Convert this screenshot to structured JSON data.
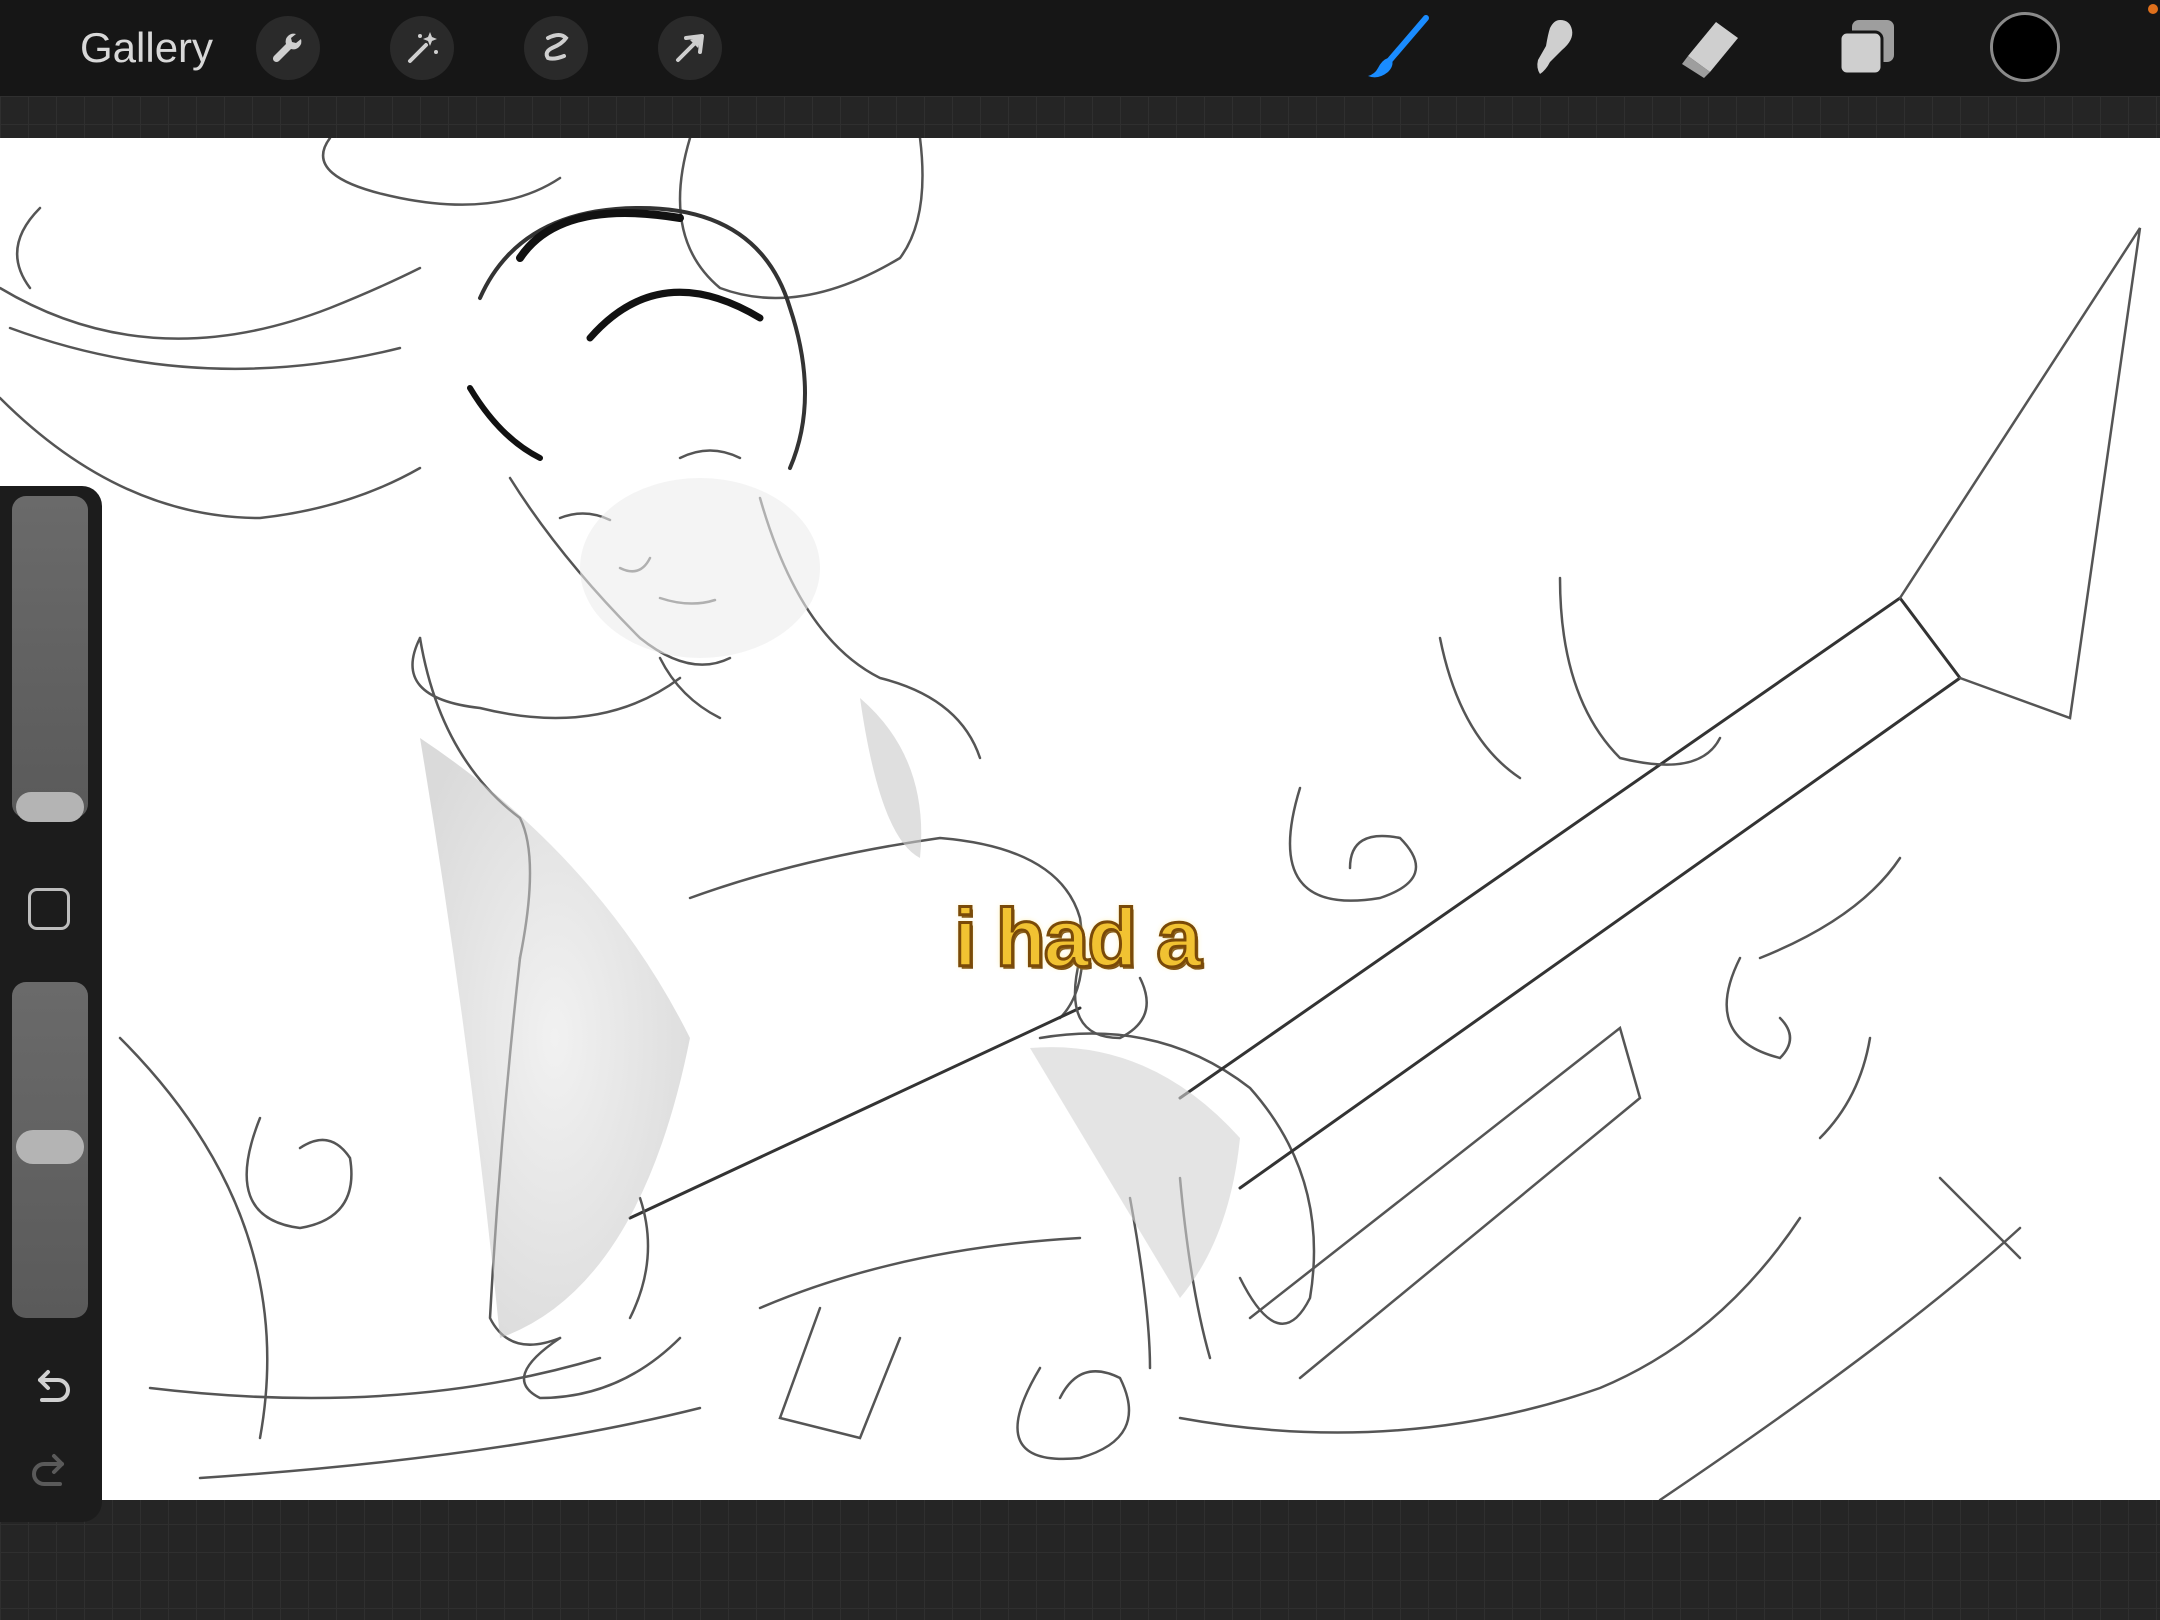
{
  "toolbar": {
    "gallery_label": "Gallery",
    "left_tools": [
      "wrench-icon",
      "magic-wand-icon",
      "selection-icon",
      "transform-arrow-icon"
    ],
    "right_tools": [
      "brush-icon",
      "smudge-icon",
      "eraser-icon",
      "layers-icon"
    ],
    "active_tool": "brush-icon",
    "accent_color": "#1a8cff",
    "current_color": "#000000"
  },
  "caption": {
    "text": "i had a",
    "fill_color": "#f1c232",
    "outline_color": "#7a4a08"
  },
  "sidebar": {
    "size_slider_level": 0.05,
    "opacity_slider_level": 0.5,
    "tools": [
      "modify-square-icon",
      "undo-icon",
      "redo-icon"
    ]
  }
}
